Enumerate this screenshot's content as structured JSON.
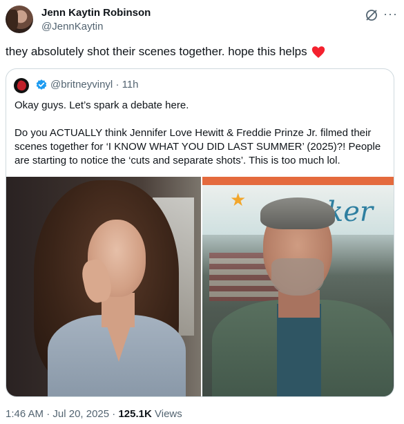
{
  "author": {
    "name": "Jenn Kaytin Robinson",
    "handle": "@JennKaytin"
  },
  "tweet": {
    "text": "they absolutely shot their scenes together. hope this helps",
    "emoji": "red-heart"
  },
  "header_icons": {
    "grok": "grok-icon",
    "more": "···"
  },
  "quoted": {
    "handle": "@britneyvinyl",
    "separator": "·",
    "time": "11h",
    "verified": true,
    "line1": "Okay guys. Let’s spark a debate here.",
    "line2": "Do you ACTUALLY think Jennifer Love Hewitt & Freddie Prinze Jr. filmed their",
    "line3": "scenes together for ‘I KNOW WHAT YOU DID LAST SUMMER’ (2025)?! People",
    "line4": "are starting to notice the ‘cuts and separate shots’. This is too much lol."
  },
  "meta": {
    "time": "1:46 AM",
    "date": "Jul 20, 2025",
    "separator": "·",
    "views_count": "125.1K",
    "views_label": "Views"
  },
  "colors": {
    "text": "#0f1419",
    "secondary": "#536471",
    "verified": "#1d9bf0",
    "heart": "#f4212e",
    "border": "#cfd9de"
  }
}
